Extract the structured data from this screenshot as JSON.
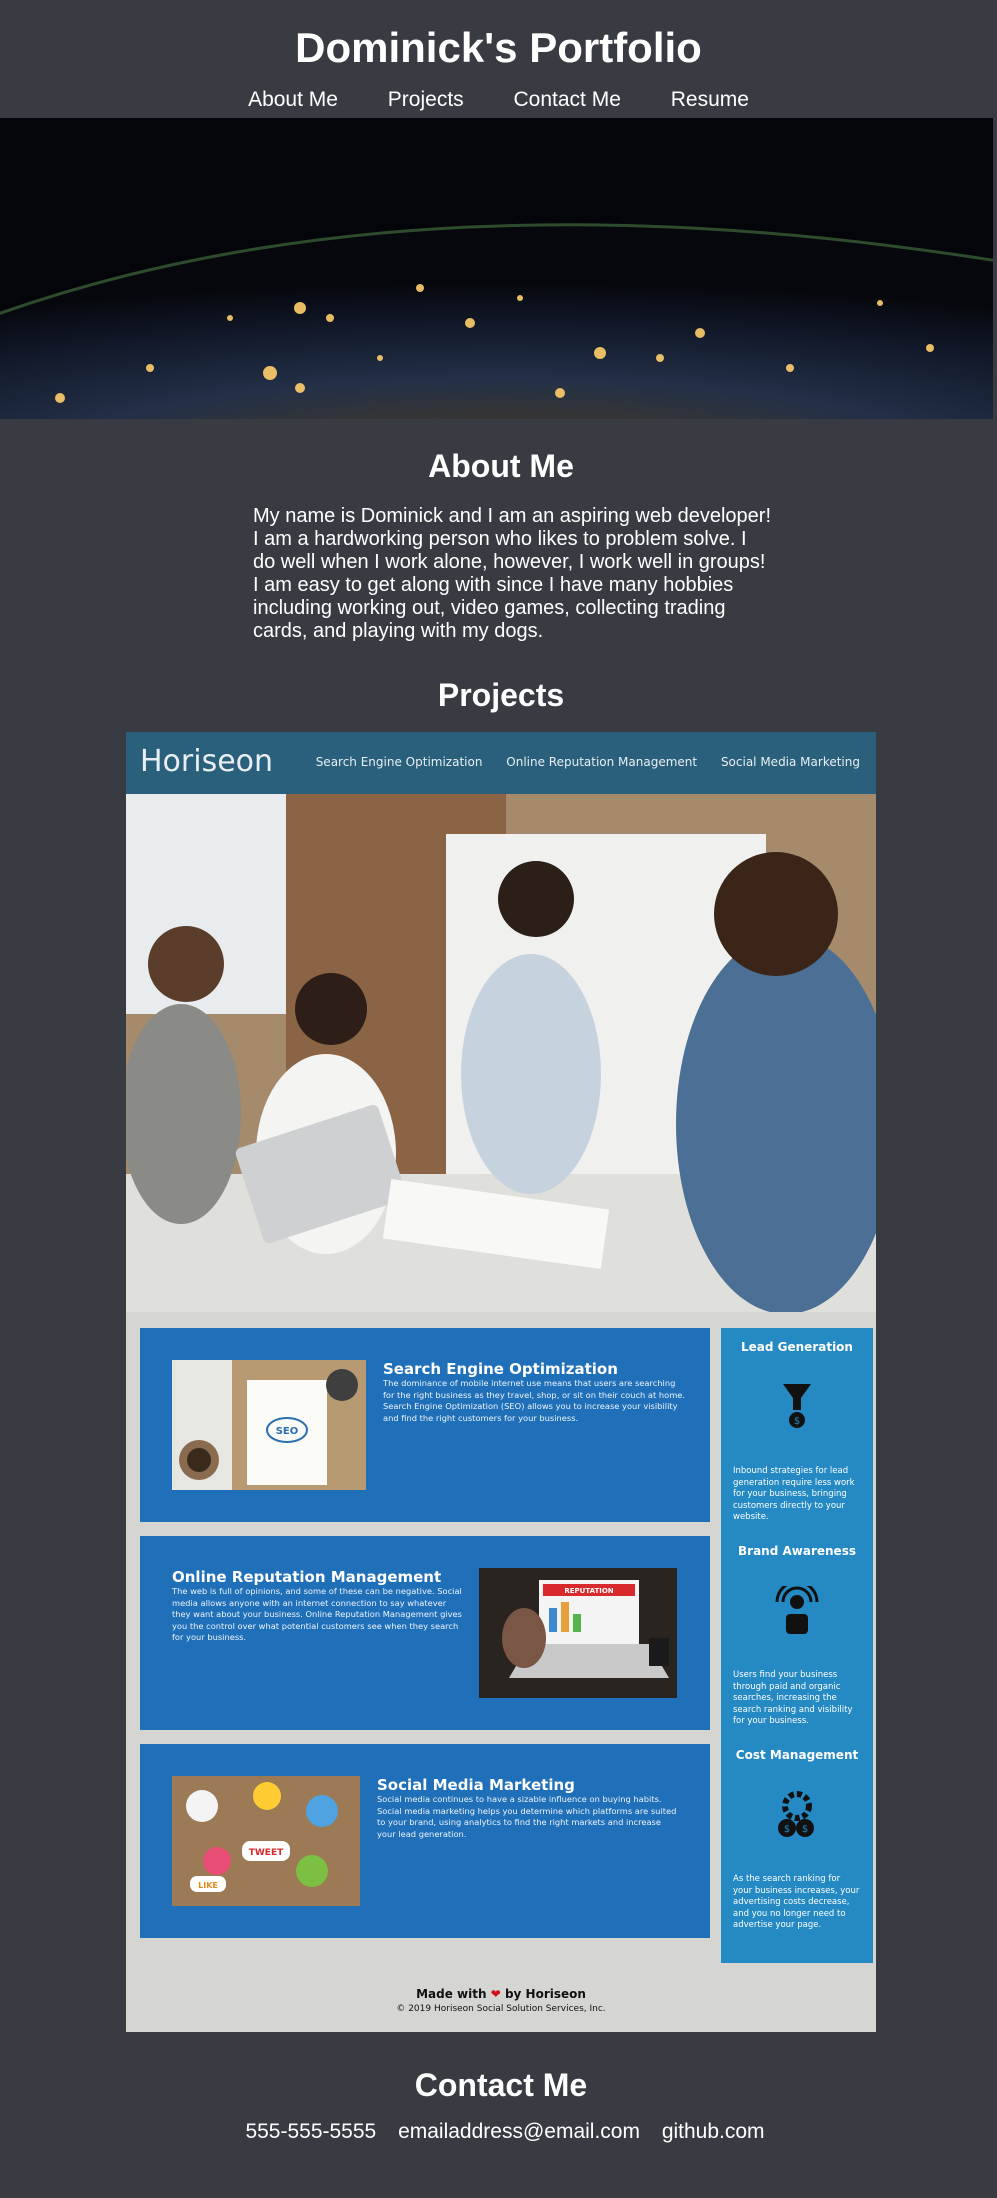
{
  "site": {
    "title": "Dominick's Portfolio"
  },
  "nav": {
    "items": [
      "About Me",
      "Projects",
      "Contact Me",
      "Resume"
    ]
  },
  "about": {
    "heading": "About Me",
    "text": "My name is Dominick and I am an aspiring web developer! I am a hardworking person who likes to problem solve. I do well when I work alone, however, I work well in groups! I am easy to get along with since I have many hobbies including working out, video games, collecting trading cards, and playing with my dogs."
  },
  "projects": {
    "heading": "Projects",
    "horiseon": {
      "logo": "Horiseon",
      "nav": [
        "Search Engine Optimization",
        "Online Reputation Management",
        "Social Media Marketing"
      ],
      "cards": [
        {
          "title": "Search Engine Optimization",
          "text": "The dominance of mobile internet use means that users are searching for the right business as they travel, shop, or sit on their couch at home. Search Engine Optimization (SEO) allows you to increase your visibility and find the right customers for your business."
        },
        {
          "title": "Online Reputation Management",
          "text": "The web is full of opinions, and some of these can be negative. Social media allows anyone with an internet connection to say whatever they want about your business. Online Reputation Management gives you the control over what potential customers see when they search for your business."
        },
        {
          "title": "Social Media Marketing",
          "text": "Social media continues to have a sizable influence on buying habits. Social media marketing helps you determine which platforms are suited to your brand, using analytics to find the right markets and increase your lead generation."
        }
      ],
      "aside": [
        {
          "title": "Lead Generation",
          "text": "Inbound strategies for lead generation require less work for your business, bringing customers directly to your website."
        },
        {
          "title": "Brand Awareness",
          "text": "Users find your business through paid and organic searches, increasing the search ranking and visibility for your business."
        },
        {
          "title": "Cost Management",
          "text": "As the search ranking for your business increases, your advertising costs decrease, and you no longer need to advertise your page."
        }
      ],
      "footer": {
        "made_prefix": "Made with",
        "heart": "❤",
        "made_suffix": "by Horiseon",
        "copyright": "© 2019 Horiseon Social Solution Services, Inc."
      },
      "image_labels": {
        "seo": "SEO",
        "reputation": "REPUTATION",
        "tweet": "TWEET",
        "like": "LIKE"
      }
    }
  },
  "contact": {
    "heading": "Contact Me",
    "phone": "555-555-5555",
    "email": "emailaddress@email.com",
    "github": "github.com"
  },
  "colors": {
    "page_bg": "#383b42",
    "horiseon_header": "#2a607c",
    "card_bg": "#1f6fb9",
    "aside_bg": "#2589c3"
  }
}
